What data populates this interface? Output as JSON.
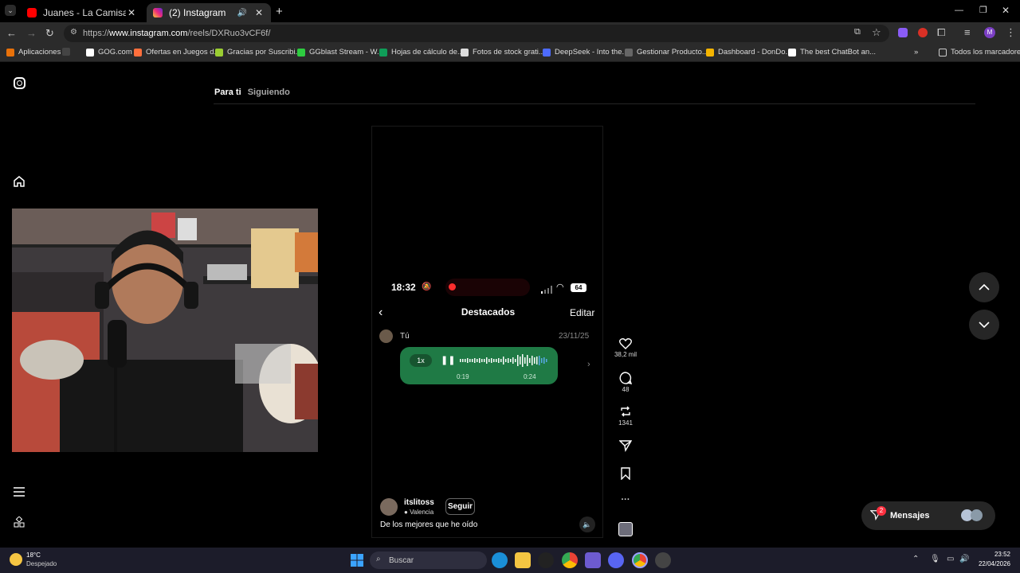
{
  "browser": {
    "tabs": [
      {
        "label": "Juanes - La Camisa Negra - You",
        "favicon_color": "#ff0000"
      },
      {
        "label": "(2) Instagram",
        "favicon_color": "#d62976"
      }
    ],
    "new_tab_label": "+",
    "url_prefix": "https://",
    "url_host": "www.instagram.com",
    "url_path": "/reels/DXRuo3vCF6f/",
    "profile_letter": "M",
    "bookmarks": [
      "Aplicaciones",
      "GOG.com",
      "Ofertas en Juegos d...",
      "Gracias por Suscribi...",
      "GGblast Stream - W...",
      "Hojas de cálculo de...",
      "Fotos de stock grati...",
      "DeepSeek - Into the...",
      "Gestionar Producto...",
      "Dashboard - DonDo...",
      "The best ChatBot an..."
    ],
    "all_bookmarks": "Todos los marcadores",
    "more": "»"
  },
  "feed": {
    "tab_for_you": "Para ti",
    "tab_following": "Siguiendo"
  },
  "reel": {
    "status_time": "18:32",
    "battery": "64",
    "chat_title": "Destacados",
    "chat_edit": "Editar",
    "sender": "Tú",
    "date": "23/11/25",
    "speed": "1x",
    "elapsed": "0:19",
    "duration": "0:24",
    "author": "itslitoss",
    "location": "Valencia",
    "follow": "Seguir",
    "caption": "De los mejores que he oído"
  },
  "actions": {
    "likes": "38,2 mil",
    "comments": "48",
    "reposts": "1341",
    "more": "···"
  },
  "messages": {
    "label": "Mensajes",
    "badge": "2"
  },
  "taskbar": {
    "temp": "18°C",
    "weather": "Despejado",
    "search": "Buscar",
    "time": "23:52",
    "date": "22/04/2026"
  },
  "colors": {
    "instagram_bg": "#000000",
    "chat_bubble": "#1f7a45",
    "badge": "#ff3040"
  }
}
